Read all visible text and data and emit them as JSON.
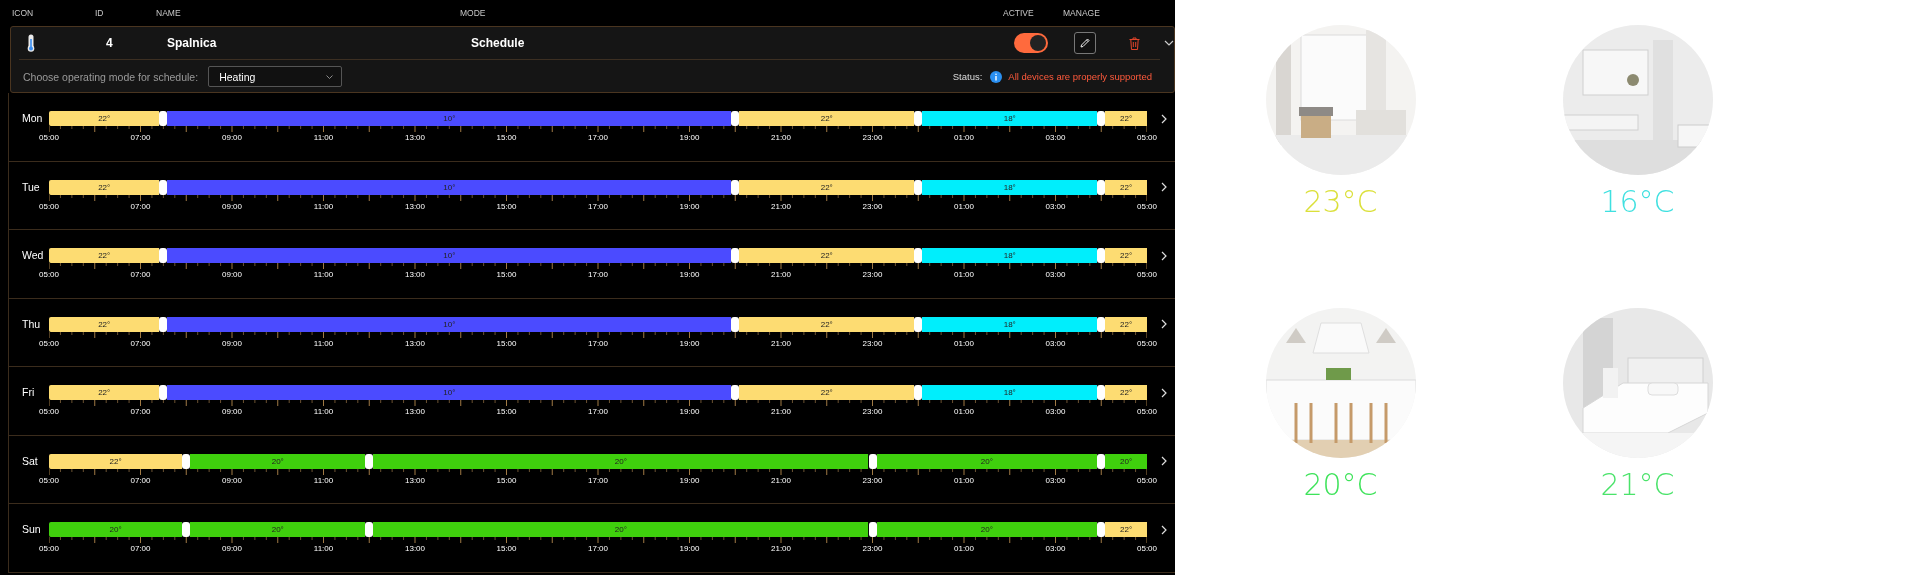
{
  "columns": [
    "ICON",
    "ID",
    "NAME",
    "MODE",
    "ACTIVE",
    "MANAGE"
  ],
  "device": {
    "id": "4",
    "name": "Spalnica",
    "mode": "Schedule",
    "active": true,
    "expanded": true
  },
  "mode_select": {
    "label": "Choose operating mode for schedule:",
    "value": "Heating"
  },
  "status": {
    "label": "Status:",
    "message": "All devices are properly supported"
  },
  "days": [
    {
      "name": "Mon",
      "segments": [
        {
          "label": "22°",
          "color": "#fddc72"
        },
        {
          "label": "10°",
          "color": "#4b4bff"
        },
        {
          "label": "22°",
          "color": "#fddc72"
        },
        {
          "label": "18°",
          "color": "#00eefc"
        },
        {
          "label": "22°",
          "color": "#fddc72"
        }
      ],
      "handles": [
        {
          "level": 0.1042
        },
        {
          "level": 0.625
        },
        {
          "level": 0.7917
        },
        {
          "level": 0.9583
        }
      ],
      "ticks": [
        "05:00",
        "07:00",
        "09:00",
        "11:00",
        "13:00",
        "15:00",
        "17:00",
        "19:00",
        "21:00",
        "23:00",
        "01:00",
        "03:00",
        "05:00"
      ]
    },
    {
      "name": "Tue",
      "segments": [
        {
          "label": "22°",
          "color": "#fddc72"
        },
        {
          "label": "10°",
          "color": "#4b4bff"
        },
        {
          "label": "22°",
          "color": "#fddc72"
        },
        {
          "label": "18°",
          "color": "#00eefc"
        },
        {
          "label": "22°",
          "color": "#fddc72"
        }
      ],
      "handles": [
        {
          "level": 0.1042
        },
        {
          "level": 0.625
        },
        {
          "level": 0.7917
        },
        {
          "level": 0.9583
        }
      ],
      "ticks": [
        "05:00",
        "07:00",
        "09:00",
        "11:00",
        "13:00",
        "15:00",
        "17:00",
        "19:00",
        "21:00",
        "23:00",
        "01:00",
        "03:00",
        "05:00"
      ]
    },
    {
      "name": "Wed",
      "segments": [
        {
          "label": "22°",
          "color": "#fddc72"
        },
        {
          "label": "10°",
          "color": "#4b4bff"
        },
        {
          "label": "22°",
          "color": "#fddc72"
        },
        {
          "label": "18°",
          "color": "#00eefc"
        },
        {
          "label": "22°",
          "color": "#fddc72"
        }
      ],
      "handles": [
        {
          "level": 0.1042
        },
        {
          "level": 0.625
        },
        {
          "level": 0.7917
        },
        {
          "level": 0.9583
        }
      ],
      "ticks": [
        "05:00",
        "07:00",
        "09:00",
        "11:00",
        "13:00",
        "15:00",
        "17:00",
        "19:00",
        "21:00",
        "23:00",
        "01:00",
        "03:00",
        "05:00"
      ]
    },
    {
      "name": "Thu",
      "segments": [
        {
          "label": "22°",
          "color": "#fddc72"
        },
        {
          "label": "10°",
          "color": "#4b4bff"
        },
        {
          "label": "22°",
          "color": "#fddc72"
        },
        {
          "label": "18°",
          "color": "#00eefc"
        },
        {
          "label": "22°",
          "color": "#fddc72"
        }
      ],
      "handles": [
        {
          "level": 0.1042
        },
        {
          "level": 0.625
        },
        {
          "level": 0.7917
        },
        {
          "level": 0.9583
        }
      ],
      "ticks": [
        "05:00",
        "07:00",
        "09:00",
        "11:00",
        "13:00",
        "15:00",
        "17:00",
        "19:00",
        "21:00",
        "23:00",
        "01:00",
        "03:00",
        "05:00"
      ]
    },
    {
      "name": "Fri",
      "segments": [
        {
          "label": "22°",
          "color": "#fddc72"
        },
        {
          "label": "10°",
          "color": "#4b4bff"
        },
        {
          "label": "22°",
          "color": "#fddc72"
        },
        {
          "label": "18°",
          "color": "#00eefc"
        },
        {
          "label": "22°",
          "color": "#fddc72"
        }
      ],
      "handles": [
        {
          "level": 0.1042
        },
        {
          "level": 0.625
        },
        {
          "level": 0.7917
        },
        {
          "level": 0.9583
        }
      ],
      "ticks": [
        "05:00",
        "07:00",
        "09:00",
        "11:00",
        "13:00",
        "15:00",
        "17:00",
        "19:00",
        "21:00",
        "23:00",
        "01:00",
        "03:00",
        "05:00"
      ]
    },
    {
      "name": "Sat",
      "segments": [
        {
          "label": "22°",
          "color": "#fddc72"
        },
        {
          "label": "20°",
          "color": "#3fd00d"
        },
        {
          "label": "20°",
          "color": "#3fd00d"
        },
        {
          "label": "20°",
          "color": "#3fd00d"
        },
        {
          "label": "20°",
          "color": "#3fd00d"
        }
      ],
      "handles": [
        {
          "level": 0.125
        },
        {
          "level": 0.2917
        },
        {
          "level": 0.75
        },
        {
          "level": 0.9583
        }
      ],
      "ticks": [
        "05:00",
        "07:00",
        "09:00",
        "11:00",
        "13:00",
        "15:00",
        "17:00",
        "19:00",
        "21:00",
        "23:00",
        "01:00",
        "03:00",
        "05:00"
      ]
    },
    {
      "name": "Sun",
      "segments": [
        {
          "label": "20°",
          "color": "#3fd00d"
        },
        {
          "label": "20°",
          "color": "#3fd00d"
        },
        {
          "label": "20°",
          "color": "#3fd00d"
        },
        {
          "label": "20°",
          "color": "#3fd00d"
        },
        {
          "label": "22°",
          "color": "#fddc72"
        }
      ],
      "handles": [
        {
          "level": 0.125
        },
        {
          "level": 0.2917
        },
        {
          "level": 0.75
        },
        {
          "level": 0.9583
        }
      ],
      "ticks": [
        "05:00",
        "07:00",
        "09:00",
        "11:00",
        "13:00",
        "15:00",
        "17:00",
        "19:00",
        "21:00",
        "23:00",
        "01:00",
        "03:00",
        "05:00"
      ]
    }
  ],
  "rooms": [
    {
      "kind": "picture",
      "temperature": "23°C",
      "color": "#dbe03a"
    },
    {
      "kind": "picture",
      "temperature": "16°C",
      "color": "#3fe0e0"
    },
    {
      "kind": "picture",
      "temperature": "20°C",
      "color": "#3ee35a"
    },
    {
      "kind": "picture",
      "temperature": "21°C",
      "color": "#4ae36a"
    }
  ]
}
